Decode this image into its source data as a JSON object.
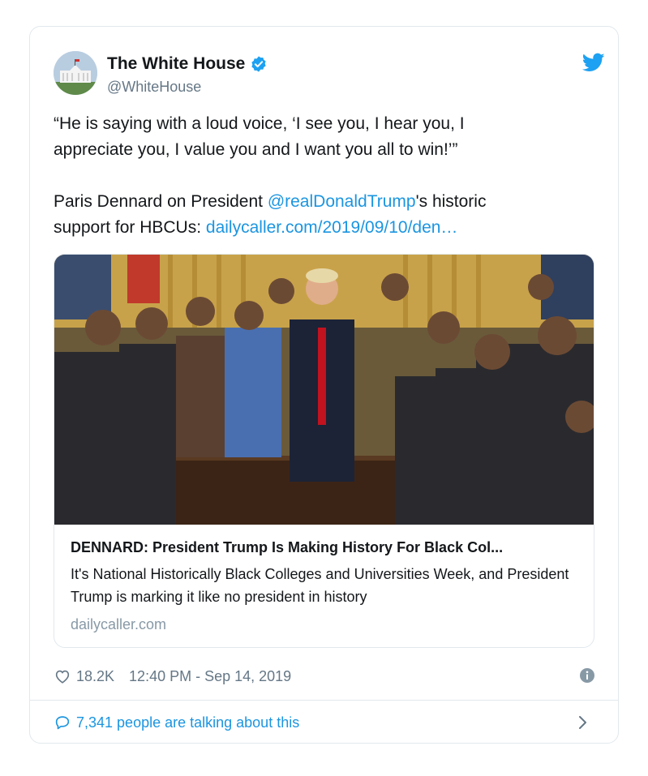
{
  "author": {
    "name": "The White House",
    "handle": "@WhiteHouse"
  },
  "tweet": {
    "quote_line1": "“He is saying with a loud voice, ‘I see you, I hear you, I",
    "quote_line2": "appreciate you, I value you and I want you all to win!’”",
    "body_pre": "Paris Dennard on President ",
    "mention": "@realDonaldTrump",
    "body_mid": "'s historic",
    "body_line2_pre": "support for HBCUs: ",
    "url": "dailycaller.com/2019/09/10/den…"
  },
  "link_card": {
    "title": "DENNARD: President Trump Is Making History For Black Col...",
    "description": "It's National Historically Black Colleges and Universities Week, and President Trump is marking it like no president in history",
    "domain": "dailycaller.com"
  },
  "meta": {
    "likes": "18.2K",
    "timestamp": "12:40 PM - Sep 14, 2019"
  },
  "footer": {
    "talking": "7,341 people are talking about this"
  },
  "icons": {
    "verified": "verified-badge-icon",
    "twitter": "twitter-bird-icon",
    "heart": "heart-icon",
    "info": "info-icon",
    "reply": "speech-bubble-icon",
    "chevron": "chevron-right-icon"
  },
  "colors": {
    "link": "#1b95e0",
    "muted": "#657786",
    "border": "#e1e8ed"
  }
}
